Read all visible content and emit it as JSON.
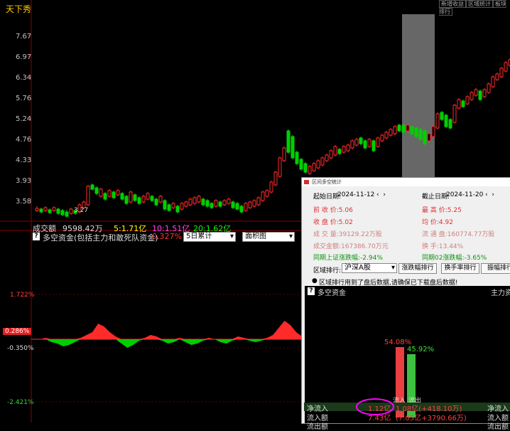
{
  "app": {
    "title": "天下秀",
    "top_buttons": [
      "新增收益",
      "区域统计",
      "板块排行"
    ]
  },
  "price_axis": {
    "labels": [
      "7.67",
      "6.97",
      "6.34",
      "5.76",
      "5.24",
      "4.76",
      "4.33",
      "3.93",
      "3.58"
    ]
  },
  "price_annotation": "3.27",
  "volume_bar": {
    "label": "成交额",
    "value": "9598.42万",
    "ma5": "5:1.71亿",
    "ma10": "10:1.51亿",
    "ma20": "20:1.62亿"
  },
  "indicator": {
    "help": "?",
    "title": "多空资金(包括主力和敢死队资金)",
    "value": "0.327%",
    "period_select": "5日累计",
    "type_select": "面积图",
    "axis": [
      "1.722%",
      "-0.350%",
      "-2.421%"
    ],
    "current_tag": "0.286%"
  },
  "dialog": {
    "title": "区间多空统计",
    "start_label": "起始日期:",
    "start_date": "2024-11-12",
    "end_label": "截止日期:",
    "end_date": "2024-11-20",
    "prev_close": "前 收 价:5.06",
    "highest": "最 高 价:5.25",
    "close": "收 盘 价:5.02",
    "avg": "均    价:4.92",
    "volume": "成 交 量:39129.22万股",
    "float": "流 通 盘:160774.77万股",
    "amount": "成交金额:167386.70万元",
    "turnover": "换    手:13.44%",
    "same_index": "同期上证涨跌幅:-2.94%",
    "same_index2": "同期02涨跌幅:-3.65%",
    "region_label": "区域排行:",
    "region_select": "沪深A股",
    "btn_change": "涨跌幅排行",
    "btn_turnover": "换手率排行",
    "btn_amp": "振幅排行",
    "note": "区域排行用到了盘后数据,请确保已下载盘后数据!",
    "panel_title": "多空资金",
    "panel_right": "主力资",
    "inflow_pct": "54.08%",
    "outflow_pct": "45.92%",
    "inflow_label": "流入",
    "outflow_label": "流出",
    "rows": [
      {
        "label": "净流入",
        "v1": "1.12亿",
        "v2": "1.08亿(+418.10万)",
        "right": "净流入"
      },
      {
        "label": "流入额",
        "v1": "7.43亿",
        "v2": "(7.05亿+3790.66万)",
        "right": "流入额"
      },
      {
        "label": "流出额",
        "v1": "",
        "v2": "",
        "right": "流出额"
      }
    ]
  },
  "colors": {
    "up": "#ff2a2a",
    "down": "#00d000",
    "accent": "#ffcc00",
    "magenta": "#ff00ff"
  }
}
